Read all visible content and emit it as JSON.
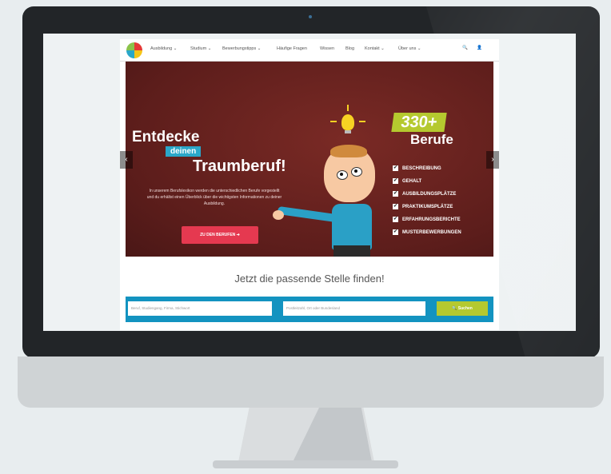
{
  "navbar": {
    "items": [
      "Ausbildung ⌄",
      "Studium ⌄",
      "Bewerbungstipps ⌄",
      "Häufige Fragen",
      "Wissen",
      "Blog",
      "Kontakt ⌄",
      "Über uns ⌄"
    ],
    "search_icon": "🔍",
    "user_icon": "👤"
  },
  "hero": {
    "headline_1": "Entdecke",
    "headline_2": "deinen",
    "headline_3": "Traumberuf!",
    "body": "In unserem Berufslexikon werden die unterschiedlichen Berufe vorgestellt und du erhältst einen Überblick über die wichtigsten Informationen zu deiner Ausbildung.",
    "cta_label": "ZU DEN BERUFEN  ➜",
    "count": "330+",
    "count_label": "Berufe",
    "features": [
      "BESCHREIBUNG",
      "GEHALT",
      "AUSBILDUNGSPLÄTZE",
      "PRAKTIKUMSPLÄTZE",
      "ERFAHRUNGSBERICHTE",
      "MUSTERBEWERBUNGEN"
    ],
    "prev": "‹",
    "next": "›"
  },
  "search": {
    "title": "Jetzt die passende Stelle finden!",
    "keyword_placeholder": "Beruf, Studiengang, Firma, Stichwort",
    "location_placeholder": "Postleitzahl, Ort oder Bundesland",
    "button_label": "🔍  Suchen"
  },
  "colors": {
    "hero_bg": "#5c1d1b",
    "accent_green": "#b5c92f",
    "accent_blue": "#2aa7c9",
    "cta_red": "#e53950",
    "search_bar": "#1393c0"
  }
}
